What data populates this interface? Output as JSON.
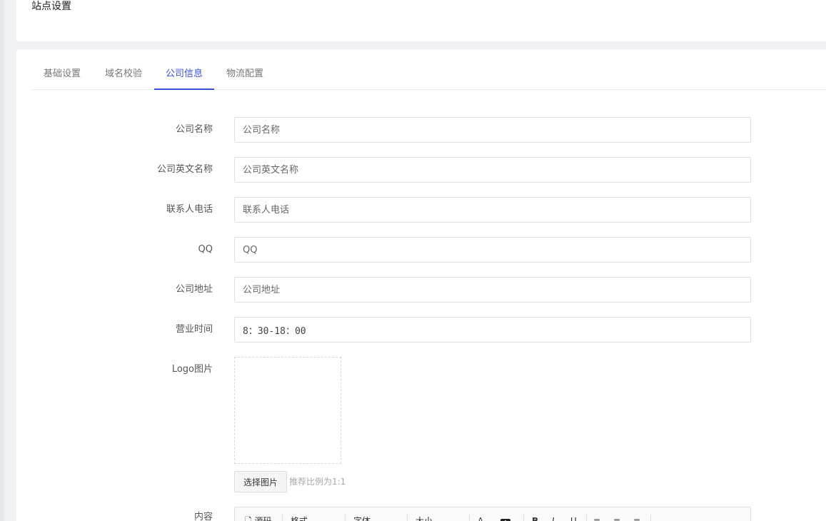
{
  "header": {
    "title": "站点设置"
  },
  "tabs": [
    {
      "label": "基础设置"
    },
    {
      "label": "域名校验"
    },
    {
      "label": "公司信息",
      "active": true
    },
    {
      "label": "物流配置"
    }
  ],
  "form": {
    "company_name": {
      "label": "公司名称",
      "placeholder": "公司名称",
      "value": ""
    },
    "company_en_name": {
      "label": "公司英文名称",
      "placeholder": "公司英文名称",
      "value": ""
    },
    "contact_phone": {
      "label": "联系人电话",
      "placeholder": "联系人电话",
      "value": ""
    },
    "qq": {
      "label": "QQ",
      "placeholder": "QQ",
      "value": ""
    },
    "company_address": {
      "label": "公司地址",
      "placeholder": "公司地址",
      "value": ""
    },
    "business_hours": {
      "label": "营业时间",
      "value": "8：30-18：00"
    },
    "logo": {
      "label": "Logo图片",
      "button": "选择图片",
      "hint": "推荐比例为1:1"
    },
    "content": {
      "label": "内容",
      "toolbar": {
        "source": "源码",
        "format": "格式",
        "font": "字体",
        "size": "大小",
        "font_color": "A",
        "bg_color": "A",
        "bold": "B",
        "italic": "I",
        "underline": "U"
      }
    }
  },
  "colors": {
    "accent": "#3b4fd8"
  }
}
